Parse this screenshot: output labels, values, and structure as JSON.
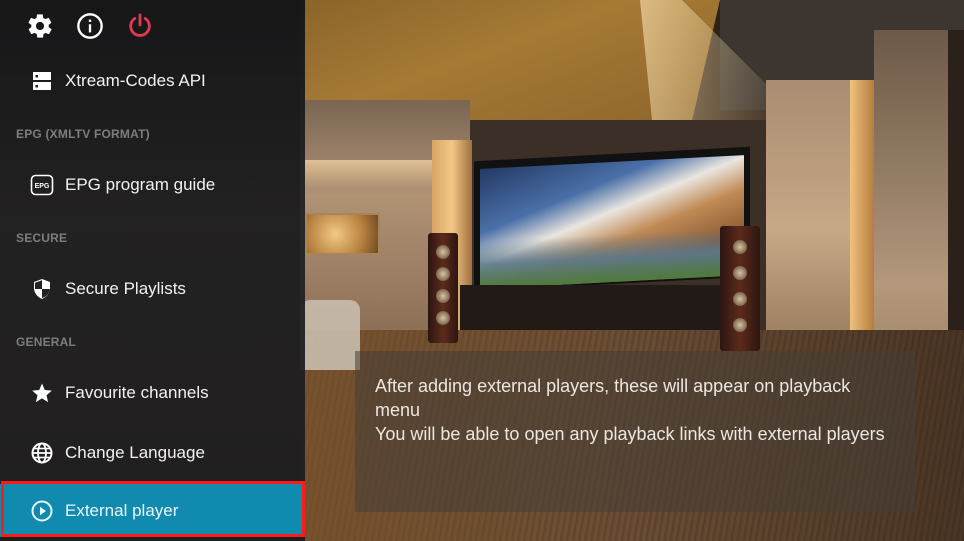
{
  "top_icons": [
    {
      "name": "settings",
      "icon": "gear-icon"
    },
    {
      "name": "info",
      "icon": "info-icon"
    },
    {
      "name": "power",
      "icon": "power-icon",
      "color": "#e23a55"
    }
  ],
  "sidebar": {
    "sections": [
      {
        "header": "",
        "items": [
          {
            "label": "Xtream-Codes API",
            "icon": "server-icon"
          }
        ]
      },
      {
        "header": "EPG (XMLTV FORMAT)",
        "items": [
          {
            "label": "EPG program guide",
            "icon": "epg-icon",
            "icon_text": "EPG"
          }
        ]
      },
      {
        "header": "SECURE",
        "items": [
          {
            "label": "Secure Playlists",
            "icon": "shield-icon"
          }
        ]
      },
      {
        "header": "GENERAL",
        "items": [
          {
            "label": "Favourite channels",
            "icon": "star-icon"
          },
          {
            "label": "Change Language",
            "icon": "globe-icon"
          },
          {
            "label": "External player",
            "icon": "play-circle-icon",
            "selected": true
          }
        ]
      }
    ],
    "selected_item": "External player",
    "accent_color": "#118ab0",
    "focus_outline_color": "#ff1a1a"
  },
  "info_panel": {
    "lines": [
      "After adding external players, these will appear on playback menu",
      "You will be able to open any playback links with external players"
    ]
  }
}
